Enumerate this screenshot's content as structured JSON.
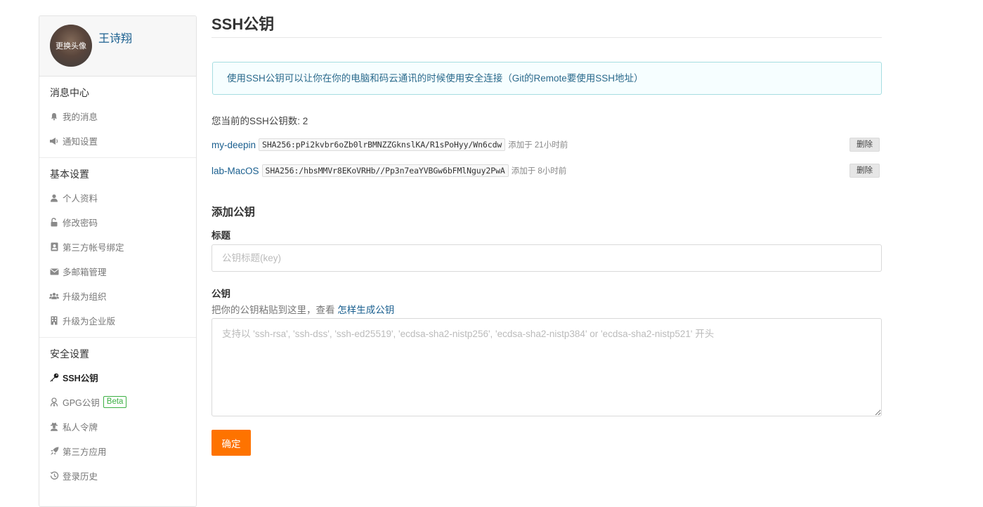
{
  "profile": {
    "username": "王诗翔",
    "avatar_overlay": "更换头像"
  },
  "sidebar": {
    "sections": [
      {
        "title": "消息中心",
        "items": [
          {
            "label": "我的消息",
            "icon": "bell-icon"
          },
          {
            "label": "通知设置",
            "icon": "megaphone-icon"
          }
        ]
      },
      {
        "title": "基本设置",
        "items": [
          {
            "label": "个人资料",
            "icon": "user-icon"
          },
          {
            "label": "修改密码",
            "icon": "unlock-icon"
          },
          {
            "label": "第三方帐号绑定",
            "icon": "contact-card-icon"
          },
          {
            "label": "多邮箱管理",
            "icon": "envelope-icon"
          },
          {
            "label": "升级为组织",
            "icon": "users-icon"
          },
          {
            "label": "升级为企业版",
            "icon": "building-icon"
          }
        ]
      },
      {
        "title": "安全设置",
        "items": [
          {
            "label": "SSH公钥",
            "icon": "key-icon",
            "active": true
          },
          {
            "label": "GPG公钥",
            "icon": "user-secret-icon",
            "badge": "Beta"
          },
          {
            "label": "私人令牌",
            "icon": "spy-icon"
          },
          {
            "label": "第三方应用",
            "icon": "rocket-icon"
          },
          {
            "label": "登录历史",
            "icon": "history-icon"
          }
        ]
      }
    ]
  },
  "main": {
    "title": "SSH公钥",
    "info": "使用SSH公钥可以让你在你的电脑和码云通讯的时候使用安全连接（Git的Remote要使用SSH地址）",
    "key_count_label": "您当前的SSH公钥数: 2",
    "keys": [
      {
        "name": "my-deepin",
        "fingerprint": "SHA256:pPi2kvbr6oZb0lrBMNZZGknslKA/R1sPoHyy/Wn6cdw",
        "added": "添加于 21小时前",
        "delete_label": "删除"
      },
      {
        "name": "lab-MacOS",
        "fingerprint": "SHA256:/hbsMMVr8EKoVRHb//Pp3n7eaYVBGw6bFMlNguy2PwA",
        "added": "添加于 8小时前",
        "delete_label": "删除"
      }
    ],
    "add_title": "添加公钥",
    "title_label": "标题",
    "title_placeholder": "公钥标题(key)",
    "title_value": "",
    "pubkey_label": "公钥",
    "pubkey_hint": "把你的公钥粘贴到这里，查看",
    "pubkey_hint_link": "怎样生成公钥",
    "pubkey_placeholder": "支持以 'ssh-rsa', 'ssh-dss', 'ssh-ed25519', 'ecdsa-sha2-nistp256', 'ecdsa-sha2-nistp384' or 'ecdsa-sha2-nistp521' 开头",
    "pubkey_value": "",
    "submit_label": "确定"
  },
  "colors": {
    "accent": "#fe7300",
    "link": "#1a5f8f",
    "info_border": "#a6dde1",
    "info_bg": "#f6feff",
    "badge_green": "#3cb043"
  }
}
